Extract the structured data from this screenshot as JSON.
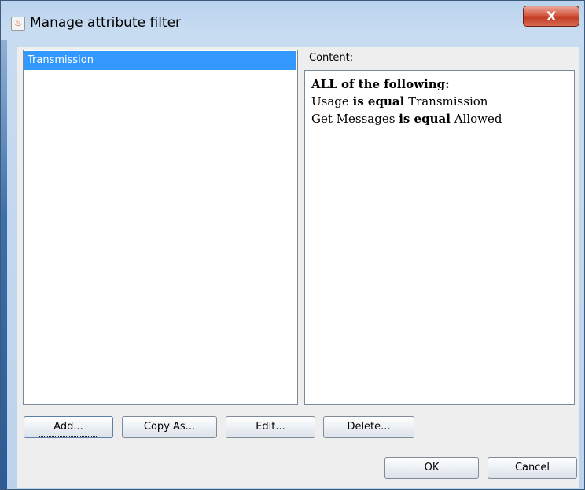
{
  "window": {
    "title": "Manage attribute filter",
    "close_label": "X"
  },
  "filters": {
    "items": [
      "Transmission"
    ]
  },
  "content": {
    "label": "Content:",
    "header": "ALL of the following:",
    "rules": [
      {
        "attribute": "Usage",
        "operator": "is equal",
        "value": "Transmission"
      },
      {
        "attribute": "Get Messages",
        "operator": "is equal",
        "value": "Allowed"
      }
    ]
  },
  "buttons": {
    "add": "Add...",
    "copy_as": "Copy As...",
    "edit": "Edit...",
    "delete": "Delete...",
    "ok": "OK",
    "cancel": "Cancel"
  },
  "colors": {
    "selection": "#3399ff",
    "titlebar": "#c8dcf1",
    "close": "#c23a22"
  },
  "icons": {
    "app": "java-cup-icon"
  }
}
